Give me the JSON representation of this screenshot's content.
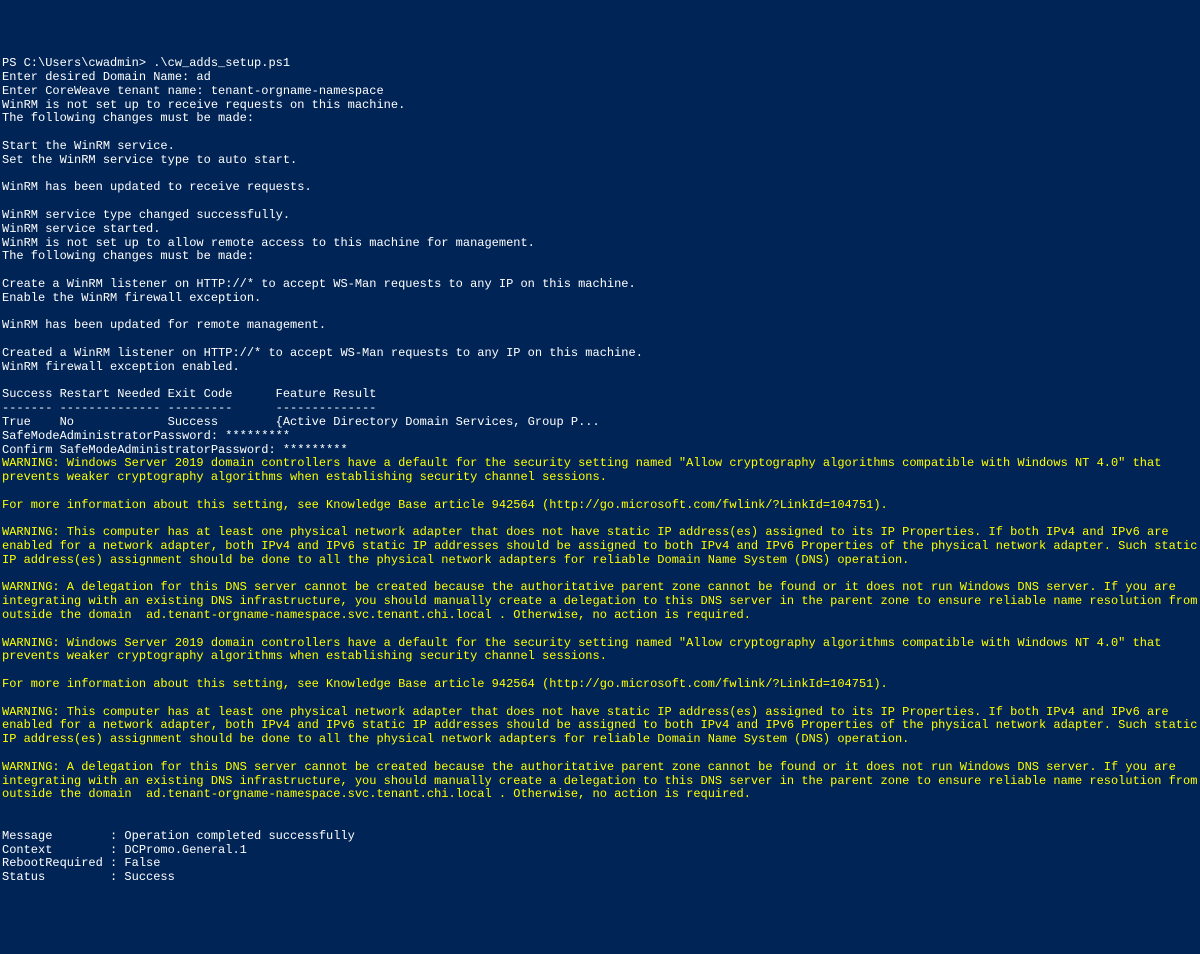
{
  "terminal": {
    "lines": [
      {
        "text": "PS C:\\Users\\cwadmin> .\\cw_adds_setup.ps1",
        "cls": "normal"
      },
      {
        "text": "Enter desired Domain Name: ad",
        "cls": "normal"
      },
      {
        "text": "Enter CoreWeave tenant name: tenant-orgname-namespace",
        "cls": "normal"
      },
      {
        "text": "WinRM is not set up to receive requests on this machine.",
        "cls": "normal"
      },
      {
        "text": "The following changes must be made:",
        "cls": "normal"
      },
      {
        "text": "",
        "cls": "blank"
      },
      {
        "text": "Start the WinRM service.",
        "cls": "normal"
      },
      {
        "text": "Set the WinRM service type to auto start.",
        "cls": "normal"
      },
      {
        "text": "",
        "cls": "blank"
      },
      {
        "text": "WinRM has been updated to receive requests.",
        "cls": "normal"
      },
      {
        "text": "",
        "cls": "blank"
      },
      {
        "text": "WinRM service type changed successfully.",
        "cls": "normal"
      },
      {
        "text": "WinRM service started.",
        "cls": "normal"
      },
      {
        "text": "WinRM is not set up to allow remote access to this machine for management.",
        "cls": "normal"
      },
      {
        "text": "The following changes must be made:",
        "cls": "normal"
      },
      {
        "text": "",
        "cls": "blank"
      },
      {
        "text": "Create a WinRM listener on HTTP://* to accept WS-Man requests to any IP on this machine.",
        "cls": "normal"
      },
      {
        "text": "Enable the WinRM firewall exception.",
        "cls": "normal"
      },
      {
        "text": "",
        "cls": "blank"
      },
      {
        "text": "WinRM has been updated for remote management.",
        "cls": "normal"
      },
      {
        "text": "",
        "cls": "blank"
      },
      {
        "text": "Created a WinRM listener on HTTP://* to accept WS-Man requests to any IP on this machine.",
        "cls": "normal"
      },
      {
        "text": "WinRM firewall exception enabled.",
        "cls": "normal"
      },
      {
        "text": "",
        "cls": "blank"
      },
      {
        "text": "Success Restart Needed Exit Code      Feature Result",
        "cls": "normal"
      },
      {
        "text": "------- -------------- ---------      --------------",
        "cls": "normal"
      },
      {
        "text": "True    No             Success        {Active Directory Domain Services, Group P...",
        "cls": "normal"
      },
      {
        "text": "SafeModeAdministratorPassword: *********",
        "cls": "normal"
      },
      {
        "text": "Confirm SafeModeAdministratorPassword: *********",
        "cls": "normal"
      },
      {
        "text": "WARNING: Windows Server 2019 domain controllers have a default for the security setting named \"Allow cryptography algorithms compatible with Windows NT 4.0\" that prevents weaker cryptography algorithms when establishing security channel sessions.",
        "cls": "warning"
      },
      {
        "text": "",
        "cls": "blank"
      },
      {
        "text": "For more information about this setting, see Knowledge Base article 942564 (http://go.microsoft.com/fwlink/?LinkId=104751).",
        "cls": "warning"
      },
      {
        "text": "",
        "cls": "blank"
      },
      {
        "text": "WARNING: This computer has at least one physical network adapter that does not have static IP address(es) assigned to its IP Properties. If both IPv4 and IPv6 are enabled for a network adapter, both IPv4 and IPv6 static IP addresses should be assigned to both IPv4 and IPv6 Properties of the physical network adapter. Such static IP address(es) assignment should be done to all the physical network adapters for reliable Domain Name System (DNS) operation.",
        "cls": "warning"
      },
      {
        "text": "",
        "cls": "blank"
      },
      {
        "text": "WARNING: A delegation for this DNS server cannot be created because the authoritative parent zone cannot be found or it does not run Windows DNS server. If you are integrating with an existing DNS infrastructure, you should manually create a delegation to this DNS server in the parent zone to ensure reliable name resolution from outside the domain  ad.tenant-orgname-namespace.svc.tenant.chi.local . Otherwise, no action is required.",
        "cls": "warning"
      },
      {
        "text": "",
        "cls": "blank"
      },
      {
        "text": "WARNING: Windows Server 2019 domain controllers have a default for the security setting named \"Allow cryptography algorithms compatible with Windows NT 4.0\" that prevents weaker cryptography algorithms when establishing security channel sessions.",
        "cls": "warning"
      },
      {
        "text": "",
        "cls": "blank"
      },
      {
        "text": "For more information about this setting, see Knowledge Base article 942564 (http://go.microsoft.com/fwlink/?LinkId=104751).",
        "cls": "warning"
      },
      {
        "text": "",
        "cls": "blank"
      },
      {
        "text": "WARNING: This computer has at least one physical network adapter that does not have static IP address(es) assigned to its IP Properties. If both IPv4 and IPv6 are enabled for a network adapter, both IPv4 and IPv6 static IP addresses should be assigned to both IPv4 and IPv6 Properties of the physical network adapter. Such static IP address(es) assignment should be done to all the physical network adapters for reliable Domain Name System (DNS) operation.",
        "cls": "warning"
      },
      {
        "text": "",
        "cls": "blank"
      },
      {
        "text": "WARNING: A delegation for this DNS server cannot be created because the authoritative parent zone cannot be found or it does not run Windows DNS server. If you are integrating with an existing DNS infrastructure, you should manually create a delegation to this DNS server in the parent zone to ensure reliable name resolution from outside the domain  ad.tenant-orgname-namespace.svc.tenant.chi.local . Otherwise, no action is required.",
        "cls": "warning"
      },
      {
        "text": "",
        "cls": "blank"
      },
      {
        "text": "",
        "cls": "blank"
      },
      {
        "text": "Message        : Operation completed successfully",
        "cls": "normal"
      },
      {
        "text": "Context        : DCPromo.General.1",
        "cls": "normal"
      },
      {
        "text": "RebootRequired : False",
        "cls": "normal"
      },
      {
        "text": "Status         : Success",
        "cls": "normal"
      }
    ]
  }
}
